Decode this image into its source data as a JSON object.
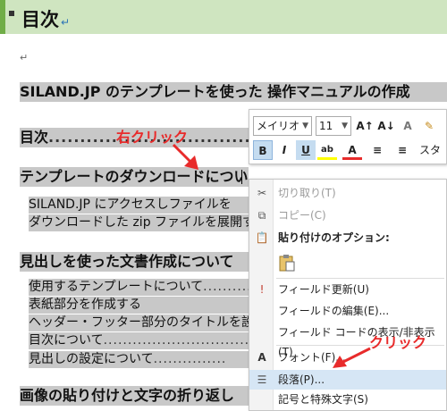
{
  "doc": {
    "heading": "目次",
    "title_line": "SILAND.JP のテンプレートを使った 操作マニュアルの作成",
    "toc_line": "目次",
    "sections": [
      {
        "title": "テンプレートのダウンロードについて",
        "items": [
          "SILAND.JP にアクセスしファイルを",
          "ダウンロードした zip ファイルを展開す"
        ]
      },
      {
        "title": "見出しを使った文書作成について",
        "items": [
          "使用するテンプレートについて",
          "表紙部分を作成する",
          "ヘッダー・フッター部分のタイトルを設",
          "目次について",
          "見出しの設定について"
        ]
      },
      {
        "title": "画像の貼り付けと文字の折り返し"
      }
    ]
  },
  "annotations": {
    "right_click": "右クリック",
    "click": "クリック"
  },
  "mini_toolbar": {
    "font": "メイリオ",
    "size": "11",
    "row1_buttons": [
      "A↑",
      "A↓",
      "A",
      "✎"
    ],
    "row2_buttons": [
      "B",
      "I",
      "U",
      "ab",
      "A",
      "≡",
      "≡",
      "スタ"
    ]
  },
  "context_menu": {
    "cut": "切り取り(T)",
    "copy": "コピー(C)",
    "paste_options": "貼り付けのオプション:",
    "field_update": "フィールド更新(U)",
    "field_edit": "フィールドの編集(E)...",
    "field_code_toggle": "フィールド コードの表示/非表示(T)",
    "font": "フォント(F)...",
    "paragraph": "段落(P)...",
    "symbols": "記号と特殊文字(S)"
  },
  "colors": {
    "accent_red": "#e82b2b",
    "heading_bg": "#cfe5c0",
    "highlight": "#d6e6f5"
  }
}
